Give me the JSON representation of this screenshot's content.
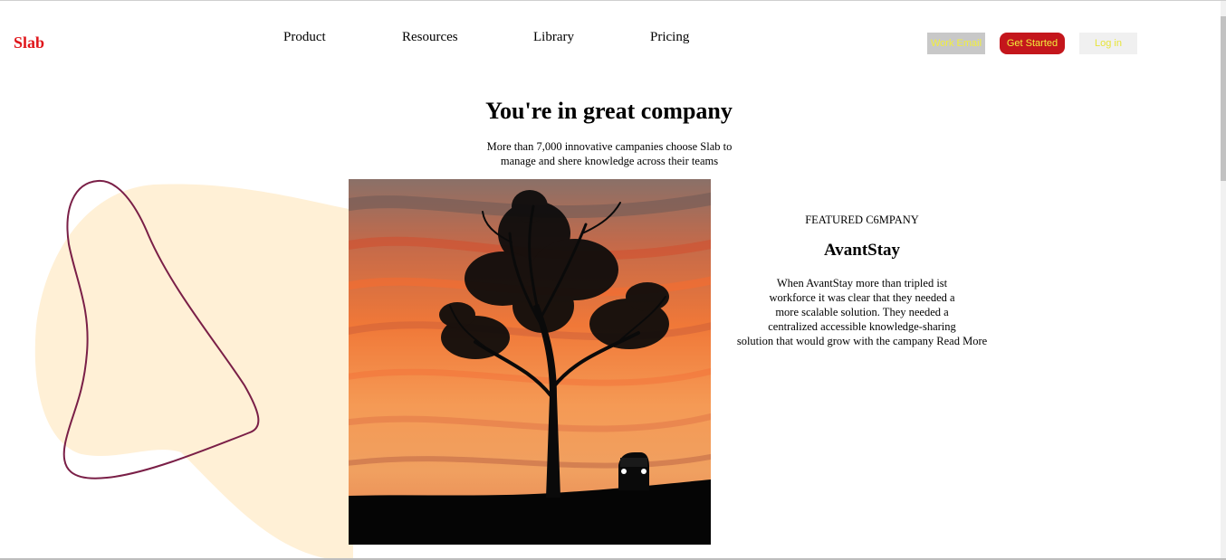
{
  "header": {
    "logo": "Slab",
    "nav": [
      "Product",
      "Resources",
      "Library",
      "Pricing"
    ],
    "work_email": "Work Email",
    "get_started": "Get Started",
    "login": "Log in"
  },
  "hero": {
    "title": "You're in great company",
    "subtitle_lines": [
      "More than 7,000 innovative campanies choose Slab to",
      "manage and shere knowledge across their teams"
    ]
  },
  "featured": {
    "label": "FEATURED C6MPANY",
    "company": "AvantStay",
    "description_lines": [
      "When AvantStay more than tripled ist",
      "workforce it was clear that they needed a",
      "more scalable solution. They needed a",
      "centralized accessible knowledge-sharing",
      "solution that would grow with the campany Read More"
    ]
  },
  "colors": {
    "brand_red": "#e0161b",
    "button_red": "#c4161c",
    "button_text_yellow": "#f2ef3c",
    "blob_fill": "#fff0d6",
    "outline_stroke": "#7a1f47"
  },
  "icons": {
    "photo": "tree-silhouette-sunset-image",
    "decor": "blob-outline-shape"
  }
}
